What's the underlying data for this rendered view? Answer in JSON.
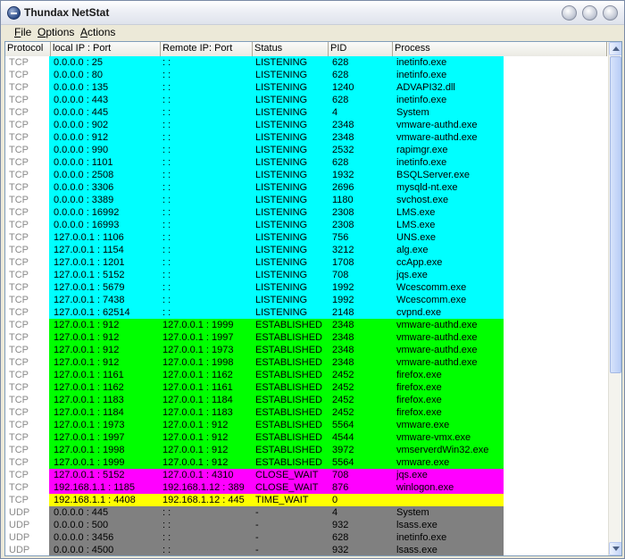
{
  "window": {
    "title": "Thundax NetStat"
  },
  "menu": {
    "file": "F",
    "file_rest": "ile",
    "options": "O",
    "options_rest": "ptions",
    "actions": "A",
    "actions_rest": "ctions"
  },
  "colors": {
    "listening": "#00ffff",
    "established": "#00ff00",
    "close_wait": "#ff00ff",
    "time_wait": "#ffff00",
    "udp": "#808080"
  },
  "table": {
    "columns": [
      "Protocol",
      "local IP : Port",
      "Remote IP: Port",
      "Status",
      "PID",
      "Process"
    ],
    "rows": [
      {
        "protocol": "TCP",
        "local": "0.0.0.0 : 25",
        "remote": ": :",
        "status": "LISTENING",
        "pid": "628",
        "process": "inetinfo.exe",
        "color": "listening"
      },
      {
        "protocol": "TCP",
        "local": "0.0.0.0 : 80",
        "remote": ": :",
        "status": "LISTENING",
        "pid": "628",
        "process": "inetinfo.exe",
        "color": "listening"
      },
      {
        "protocol": "TCP",
        "local": "0.0.0.0 : 135",
        "remote": ": :",
        "status": "LISTENING",
        "pid": "1240",
        "process": "ADVAPI32.dll",
        "color": "listening"
      },
      {
        "protocol": "TCP",
        "local": "0.0.0.0 : 443",
        "remote": ": :",
        "status": "LISTENING",
        "pid": "628",
        "process": "inetinfo.exe",
        "color": "listening"
      },
      {
        "protocol": "TCP",
        "local": "0.0.0.0 : 445",
        "remote": ": :",
        "status": "LISTENING",
        "pid": "4",
        "process": "System",
        "color": "listening"
      },
      {
        "protocol": "TCP",
        "local": "0.0.0.0 : 902",
        "remote": ": :",
        "status": "LISTENING",
        "pid": "2348",
        "process": "vmware-authd.exe",
        "color": "listening"
      },
      {
        "protocol": "TCP",
        "local": "0.0.0.0 : 912",
        "remote": ": :",
        "status": "LISTENING",
        "pid": "2348",
        "process": "vmware-authd.exe",
        "color": "listening"
      },
      {
        "protocol": "TCP",
        "local": "0.0.0.0 : 990",
        "remote": ": :",
        "status": "LISTENING",
        "pid": "2532",
        "process": "rapimgr.exe",
        "color": "listening"
      },
      {
        "protocol": "TCP",
        "local": "0.0.0.0 : 1101",
        "remote": ": :",
        "status": "LISTENING",
        "pid": "628",
        "process": "inetinfo.exe",
        "color": "listening"
      },
      {
        "protocol": "TCP",
        "local": "0.0.0.0 : 2508",
        "remote": ": :",
        "status": "LISTENING",
        "pid": "1932",
        "process": "BSQLServer.exe",
        "color": "listening"
      },
      {
        "protocol": "TCP",
        "local": "0.0.0.0 : 3306",
        "remote": ": :",
        "status": "LISTENING",
        "pid": "2696",
        "process": "mysqld-nt.exe",
        "color": "listening"
      },
      {
        "protocol": "TCP",
        "local": "0.0.0.0 : 3389",
        "remote": ": :",
        "status": "LISTENING",
        "pid": "1180",
        "process": "svchost.exe",
        "color": "listening"
      },
      {
        "protocol": "TCP",
        "local": "0.0.0.0 : 16992",
        "remote": ": :",
        "status": "LISTENING",
        "pid": "2308",
        "process": "LMS.exe",
        "color": "listening"
      },
      {
        "protocol": "TCP",
        "local": "0.0.0.0 : 16993",
        "remote": ": :",
        "status": "LISTENING",
        "pid": "2308",
        "process": "LMS.exe",
        "color": "listening"
      },
      {
        "protocol": "TCP",
        "local": "127.0.0.1 : 1106",
        "remote": ": :",
        "status": "LISTENING",
        "pid": "756",
        "process": "UNS.exe",
        "color": "listening"
      },
      {
        "protocol": "TCP",
        "local": "127.0.0.1 : 1154",
        "remote": ": :",
        "status": "LISTENING",
        "pid": "3212",
        "process": "alg.exe",
        "color": "listening"
      },
      {
        "protocol": "TCP",
        "local": "127.0.0.1 : 1201",
        "remote": ": :",
        "status": "LISTENING",
        "pid": "1708",
        "process": "ccApp.exe",
        "color": "listening"
      },
      {
        "protocol": "TCP",
        "local": "127.0.0.1 : 5152",
        "remote": ": :",
        "status": "LISTENING",
        "pid": "708",
        "process": "jqs.exe",
        "color": "listening"
      },
      {
        "protocol": "TCP",
        "local": "127.0.0.1 : 5679",
        "remote": ": :",
        "status": "LISTENING",
        "pid": "1992",
        "process": "Wcescomm.exe",
        "color": "listening"
      },
      {
        "protocol": "TCP",
        "local": "127.0.0.1 : 7438",
        "remote": ": :",
        "status": "LISTENING",
        "pid": "1992",
        "process": "Wcescomm.exe",
        "color": "listening"
      },
      {
        "protocol": "TCP",
        "local": "127.0.0.1 : 62514",
        "remote": ": :",
        "status": "LISTENING",
        "pid": "2148",
        "process": "cvpnd.exe",
        "color": "listening"
      },
      {
        "protocol": "TCP",
        "local": "127.0.0.1 : 912",
        "remote": "127.0.0.1 : 1999",
        "status": "ESTABLISHED",
        "pid": "2348",
        "process": "vmware-authd.exe",
        "color": "established"
      },
      {
        "protocol": "TCP",
        "local": "127.0.0.1 : 912",
        "remote": "127.0.0.1 : 1997",
        "status": "ESTABLISHED",
        "pid": "2348",
        "process": "vmware-authd.exe",
        "color": "established"
      },
      {
        "protocol": "TCP",
        "local": "127.0.0.1 : 912",
        "remote": "127.0.0.1 : 1973",
        "status": "ESTABLISHED",
        "pid": "2348",
        "process": "vmware-authd.exe",
        "color": "established"
      },
      {
        "protocol": "TCP",
        "local": "127.0.0.1 : 912",
        "remote": "127.0.0.1 : 1998",
        "status": "ESTABLISHED",
        "pid": "2348",
        "process": "vmware-authd.exe",
        "color": "established"
      },
      {
        "protocol": "TCP",
        "local": "127.0.0.1 : 1161",
        "remote": "127.0.0.1 : 1162",
        "status": "ESTABLISHED",
        "pid": "2452",
        "process": "firefox.exe",
        "color": "established"
      },
      {
        "protocol": "TCP",
        "local": "127.0.0.1 : 1162",
        "remote": "127.0.0.1 : 1161",
        "status": "ESTABLISHED",
        "pid": "2452",
        "process": "firefox.exe",
        "color": "established"
      },
      {
        "protocol": "TCP",
        "local": "127.0.0.1 : 1183",
        "remote": "127.0.0.1 : 1184",
        "status": "ESTABLISHED",
        "pid": "2452",
        "process": "firefox.exe",
        "color": "established"
      },
      {
        "protocol": "TCP",
        "local": "127.0.0.1 : 1184",
        "remote": "127.0.0.1 : 1183",
        "status": "ESTABLISHED",
        "pid": "2452",
        "process": "firefox.exe",
        "color": "established"
      },
      {
        "protocol": "TCP",
        "local": "127.0.0.1 : 1973",
        "remote": "127.0.0.1 : 912",
        "status": "ESTABLISHED",
        "pid": "5564",
        "process": "vmware.exe",
        "color": "established"
      },
      {
        "protocol": "TCP",
        "local": "127.0.0.1 : 1997",
        "remote": "127.0.0.1 : 912",
        "status": "ESTABLISHED",
        "pid": "4544",
        "process": "vmware-vmx.exe",
        "color": "established"
      },
      {
        "protocol": "TCP",
        "local": "127.0.0.1 : 1998",
        "remote": "127.0.0.1 : 912",
        "status": "ESTABLISHED",
        "pid": "3972",
        "process": "vmserverdWin32.exe",
        "color": "established"
      },
      {
        "protocol": "TCP",
        "local": "127.0.0.1 : 1999",
        "remote": "127.0.0.1 : 912",
        "status": "ESTABLISHED",
        "pid": "5564",
        "process": "vmware.exe",
        "color": "established"
      },
      {
        "protocol": "TCP",
        "local": "127.0.0.1 : 5152",
        "remote": "127.0.0.1 : 4310",
        "status": "CLOSE_WAIT",
        "pid": "708",
        "process": "jqs.exe",
        "color": "close_wait"
      },
      {
        "protocol": "TCP",
        "local": "192.168.1.1 : 1185",
        "remote": "192.168.1.12 : 389",
        "status": "CLOSE_WAIT",
        "pid": "876",
        "process": "winlogon.exe",
        "color": "close_wait"
      },
      {
        "protocol": "TCP",
        "local": "192.168.1.1 : 4408",
        "remote": "192.168.1.12 : 445",
        "status": "TIME_WAIT",
        "pid": "0",
        "process": "",
        "color": "time_wait"
      },
      {
        "protocol": "UDP",
        "local": "0.0.0.0 : 445",
        "remote": ": :",
        "status": "-",
        "pid": "4",
        "process": "System",
        "color": "udp"
      },
      {
        "protocol": "UDP",
        "local": "0.0.0.0 : 500",
        "remote": ": :",
        "status": "-",
        "pid": "932",
        "process": "lsass.exe",
        "color": "udp"
      },
      {
        "protocol": "UDP",
        "local": "0.0.0.0 : 3456",
        "remote": ": :",
        "status": "-",
        "pid": "628",
        "process": "inetinfo.exe",
        "color": "udp"
      },
      {
        "protocol": "UDP",
        "local": "0.0.0.0 : 4500",
        "remote": ": :",
        "status": "-",
        "pid": "932",
        "process": "lsass.exe",
        "color": "udp"
      }
    ]
  }
}
